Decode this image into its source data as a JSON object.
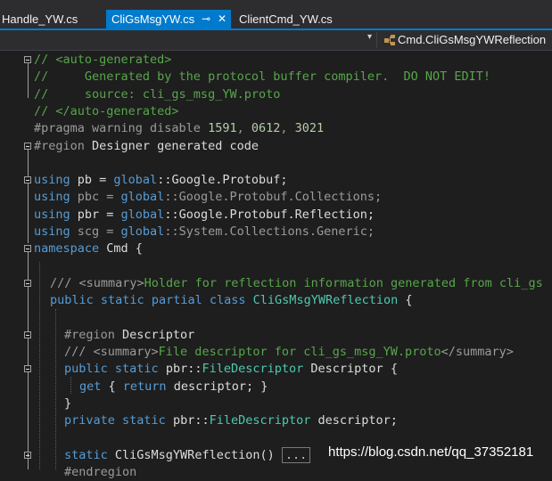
{
  "tabs": [
    {
      "label": "Handle_YW.cs"
    },
    {
      "label": "CliGsMsgYW.cs",
      "active": true,
      "pin": "⊸",
      "close": "✕"
    },
    {
      "label": "ClientCmd_YW.cs"
    }
  ],
  "navbar": {
    "dropdown_icon": "▾",
    "member_label": "Cmd.CliGsMsgYWReflection",
    "member_icon": "class-icon"
  },
  "code_lines": [
    [
      {
        "c": "c",
        "t": "// <auto-generated>"
      }
    ],
    [
      {
        "c": "c",
        "t": "//     Generated by the protocol buffer compiler.  DO NOT EDIT!"
      }
    ],
    [
      {
        "c": "c",
        "t": "//     source: cli_gs_msg_YW.proto"
      }
    ],
    [
      {
        "c": "c",
        "t": "// </auto-generated>"
      }
    ],
    [
      {
        "c": "g",
        "t": "#pragma warning disable "
      },
      {
        "c": "n",
        "t": "1591"
      },
      {
        "c": "g",
        "t": ", "
      },
      {
        "c": "n",
        "t": "0612"
      },
      {
        "c": "g",
        "t": ", "
      },
      {
        "c": "n",
        "t": "3021"
      }
    ],
    [
      {
        "c": "g",
        "t": "#region "
      },
      {
        "c": "p",
        "t": "Designer generated code"
      }
    ],
    [],
    [
      {
        "c": "k",
        "t": "using"
      },
      {
        "c": "p",
        "t": " pb = "
      },
      {
        "c": "k",
        "t": "global"
      },
      {
        "c": "p",
        "t": "::Google.Protobuf;"
      }
    ],
    [
      {
        "c": "k",
        "t": "using"
      },
      {
        "c": "g",
        "t": " pbc = "
      },
      {
        "c": "k",
        "t": "global"
      },
      {
        "c": "g",
        "t": "::Google.Protobuf.Collections;"
      }
    ],
    [
      {
        "c": "k",
        "t": "using"
      },
      {
        "c": "p",
        "t": " pbr = "
      },
      {
        "c": "k",
        "t": "global"
      },
      {
        "c": "p",
        "t": "::Google.Protobuf.Reflection;"
      }
    ],
    [
      {
        "c": "k",
        "t": "using"
      },
      {
        "c": "g",
        "t": " scg = "
      },
      {
        "c": "k",
        "t": "global"
      },
      {
        "c": "g",
        "t": "::System.Collections.Generic;"
      }
    ],
    [
      {
        "c": "k",
        "t": "namespace"
      },
      {
        "c": "p",
        "t": " Cmd {"
      }
    ],
    [],
    [
      {
        "c": "g",
        "t": "/// "
      },
      {
        "c": "g",
        "t": "<summary>"
      },
      {
        "c": "c",
        "t": "Holder for reflection information generated from cli_gs"
      }
    ],
    [
      {
        "c": "k",
        "t": "public"
      },
      {
        "c": "p",
        "t": " "
      },
      {
        "c": "k",
        "t": "static"
      },
      {
        "c": "p",
        "t": " "
      },
      {
        "c": "k",
        "t": "partial"
      },
      {
        "c": "p",
        "t": " "
      },
      {
        "c": "k",
        "t": "class"
      },
      {
        "c": "p",
        "t": " "
      },
      {
        "c": "t",
        "t": "CliGsMsgYWReflection"
      },
      {
        "c": "p",
        "t": " {"
      }
    ],
    [],
    [
      {
        "c": "g",
        "t": "#region "
      },
      {
        "c": "p",
        "t": "Descriptor"
      }
    ],
    [
      {
        "c": "g",
        "t": "/// "
      },
      {
        "c": "g",
        "t": "<summary>"
      },
      {
        "c": "c",
        "t": "File descriptor for cli_gs_msg_YW.proto"
      },
      {
        "c": "g",
        "t": "</summary>"
      }
    ],
    [
      {
        "c": "k",
        "t": "public"
      },
      {
        "c": "p",
        "t": " "
      },
      {
        "c": "k",
        "t": "static"
      },
      {
        "c": "p",
        "t": " pbr::"
      },
      {
        "c": "t",
        "t": "FileDescriptor"
      },
      {
        "c": "p",
        "t": " Descriptor {"
      }
    ],
    [
      {
        "c": "k",
        "t": "get"
      },
      {
        "c": "p",
        "t": " { "
      },
      {
        "c": "k",
        "t": "return"
      },
      {
        "c": "p",
        "t": " descriptor; }"
      }
    ],
    [
      {
        "c": "p",
        "t": "}"
      }
    ],
    [
      {
        "c": "k",
        "t": "private"
      },
      {
        "c": "p",
        "t": " "
      },
      {
        "c": "k",
        "t": "static"
      },
      {
        "c": "p",
        "t": " pbr::"
      },
      {
        "c": "t",
        "t": "FileDescriptor"
      },
      {
        "c": "p",
        "t": " descriptor;"
      }
    ],
    [],
    [
      {
        "c": "k",
        "t": "static"
      },
      {
        "c": "p",
        "t": " CliGsMsgYWReflection() "
      },
      {
        "c": "box",
        "t": "..."
      }
    ],
    [
      {
        "c": "g",
        "t": "#endregion"
      }
    ]
  ],
  "watermark": "https://blog.csdn.net/qq_37352181"
}
